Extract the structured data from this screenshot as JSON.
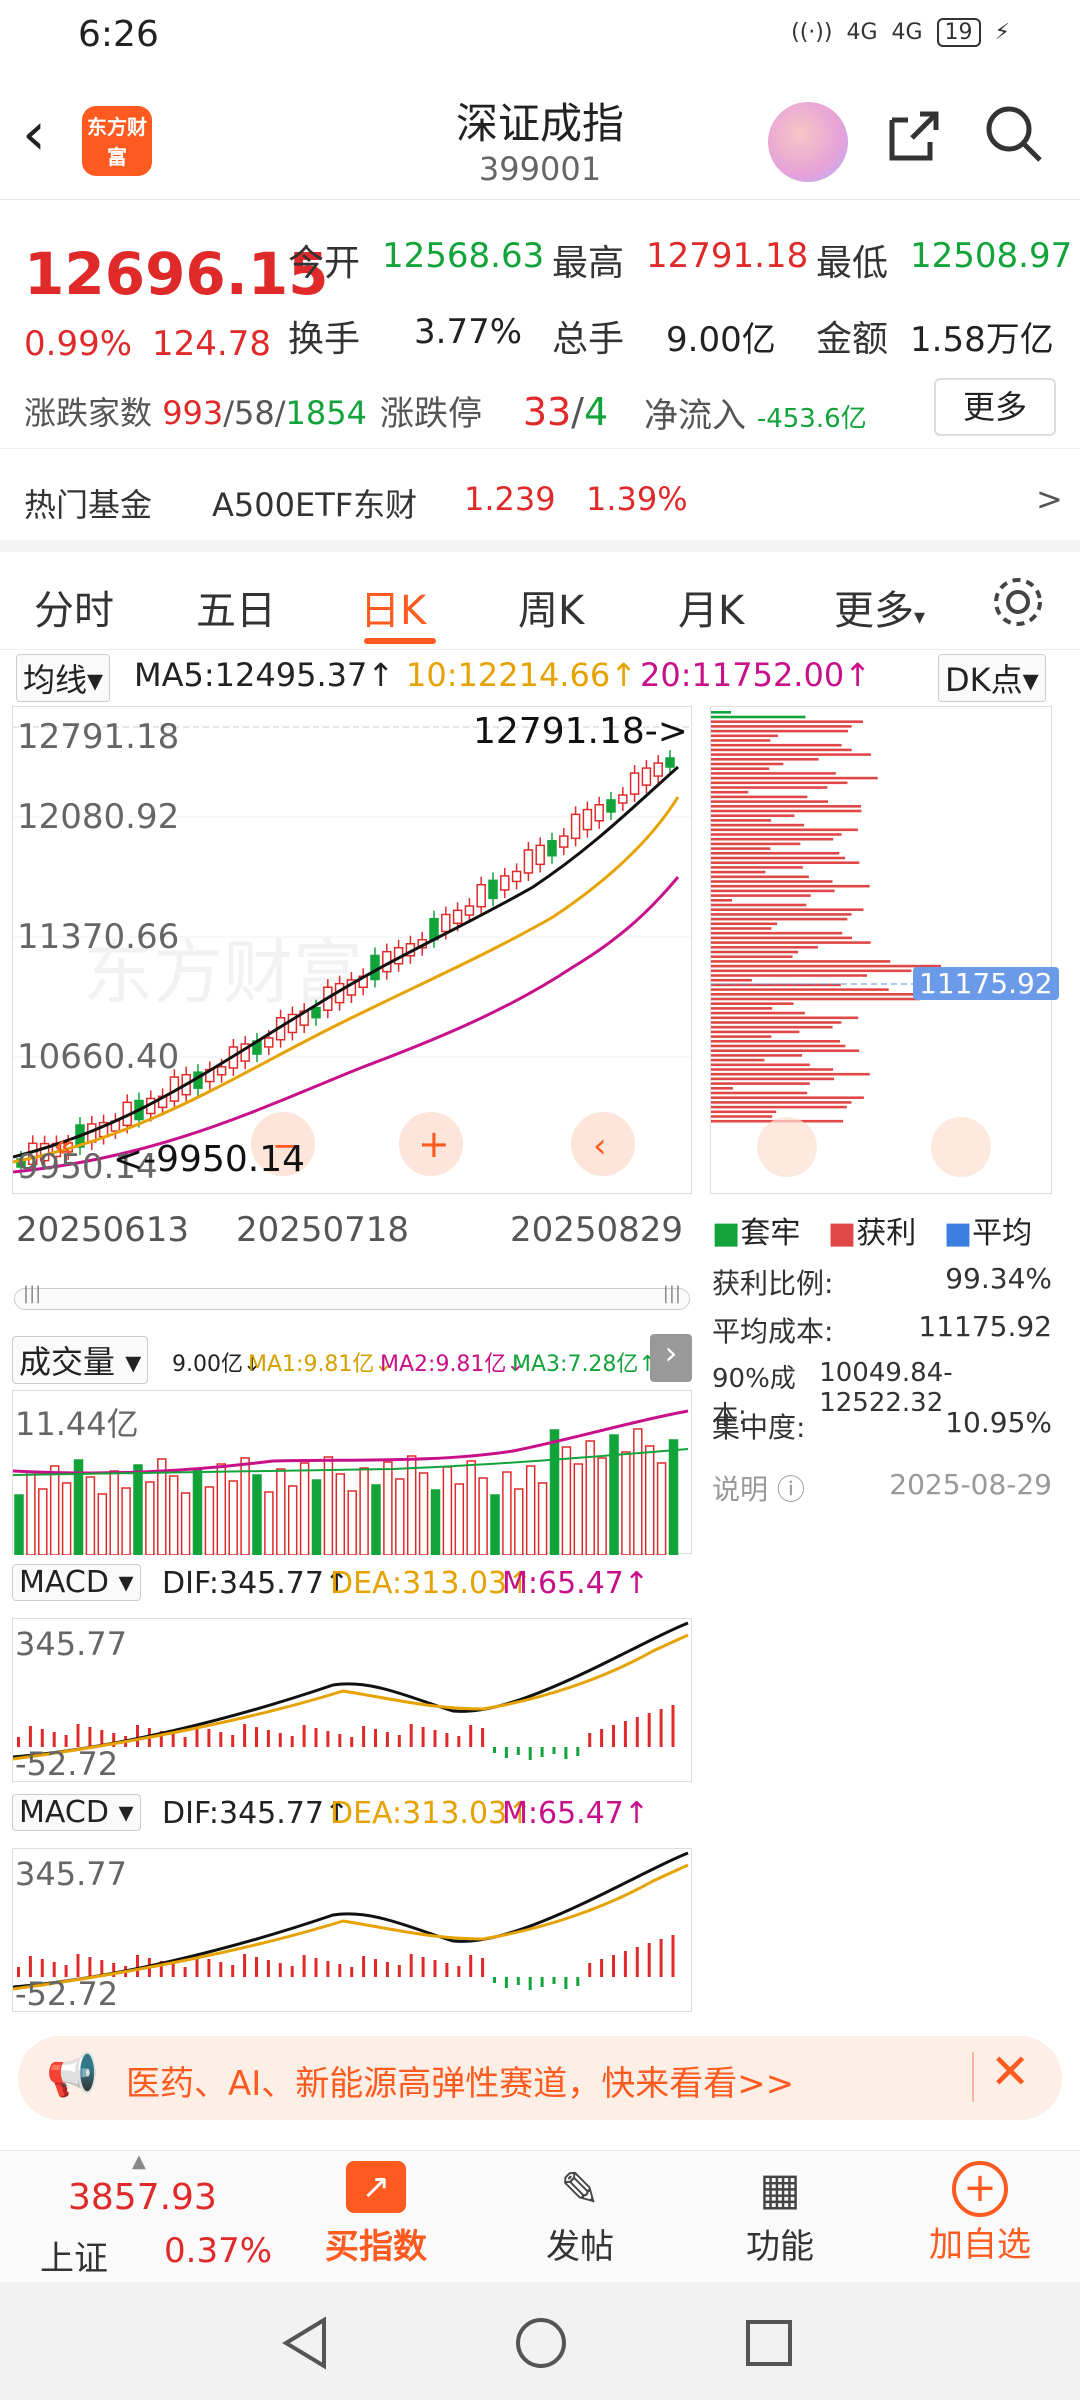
{
  "status": {
    "time": "6:26",
    "battery": "19",
    "signal1": "4G",
    "signal2": "4G"
  },
  "header": {
    "title": "深证成指",
    "code": "399001",
    "logo_text": "东方财富"
  },
  "quote": {
    "price": "12696.15",
    "pct": "0.99%",
    "change": "124.78",
    "open_label": "今开",
    "open": "12568.63",
    "high_label": "最高",
    "high": "12791.18",
    "low_label": "最低",
    "low": "12508.97",
    "turnover_label": "换手",
    "turnover": "3.77%",
    "volume_label": "总手",
    "volume": "9.00亿",
    "amount_label": "金额",
    "amount": "1.58万亿",
    "breadth_label": "涨跌家数",
    "breadth_up": "993",
    "breadth_flat": "58",
    "breadth_down": "1854",
    "limit_label": "涨跌停",
    "limit_up": "33",
    "limit_down": "4",
    "inflow_label": "净流入",
    "inflow": "-453.6亿",
    "more": "更多"
  },
  "fund": {
    "label": "热门基金",
    "name": "A500ETF东财",
    "price": "1.239",
    "pct": "1.39%",
    "arrow": ">"
  },
  "tabs": [
    "分时",
    "五日",
    "日K",
    "周K",
    "月K",
    "更多"
  ],
  "kline": {
    "selector": "均线",
    "ma5": "MA5:12495.37↑",
    "ma10": "10:12214.66↑",
    "ma20": "20:11752.00↑",
    "dk": "DK点",
    "y_labels": [
      "12791.18",
      "12080.92",
      "11370.66",
      "10660.40",
      "9950.14"
    ],
    "high_marker": "12791.18->",
    "low_marker": "<-9950.14",
    "dates": [
      "20250613",
      "20250718",
      "20250829"
    ]
  },
  "chip": {
    "avg_tag": "11175.92",
    "legend": [
      "套牢",
      "获利",
      "平均"
    ],
    "rows": [
      {
        "k": "获利比例:",
        "v": "99.34%"
      },
      {
        "k": "平均成本:",
        "v": "11175.92"
      },
      {
        "k": "90%成本:",
        "v": "10049.84-12522.32"
      },
      {
        "k": "集中度:",
        "v": "10.95%"
      }
    ],
    "note": "说明",
    "date": "2025-08-29"
  },
  "volume": {
    "selector": "成交量",
    "v": "9.00亿↓",
    "ma1": "MA1:9.81亿↓",
    "ma2": "MA2:9.81亿↓",
    "ma3": "MA3:7.28亿↑",
    "ylabel": "11.44亿"
  },
  "macd1": {
    "selector": "MACD",
    "dif": "DIF:345.77↑",
    "dea": "DEA:313.03↑",
    "m": "M:65.47↑",
    "top": "345.77",
    "bottom": "-52.72"
  },
  "macd2": {
    "selector": "MACD",
    "dif": "DIF:345.77↑",
    "dea": "DEA:313.03↑",
    "m": "M:65.47↑",
    "top": "345.77",
    "bottom": "-52.72"
  },
  "banner": {
    "text": "医药、AI、新能源高弹性赛道，快来看看>>"
  },
  "bottom": {
    "index_price": "3857.93",
    "index_name": "上证",
    "index_pct": "0.37%",
    "buy": "买指数",
    "post": "发帖",
    "func": "功能",
    "add": "加自选"
  },
  "colors": {
    "up": "#e02a2a",
    "down": "#12a33a",
    "accent": "#ff5a1f"
  }
}
